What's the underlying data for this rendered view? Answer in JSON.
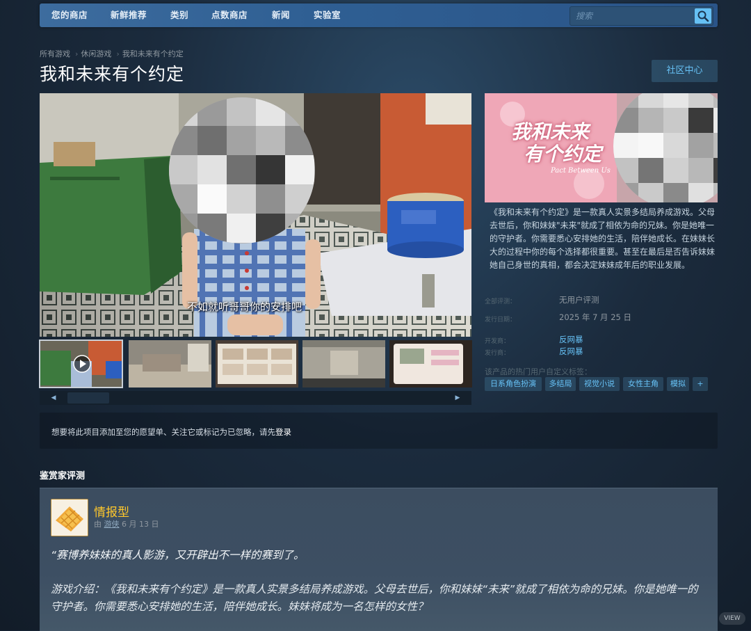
{
  "nav": {
    "tabs": [
      "您的商店",
      "新鲜推荐",
      "类别",
      "点数商店",
      "新闻",
      "实验室"
    ],
    "search_placeholder": "搜索"
  },
  "breadcrumb": [
    "所有游戏",
    "休闲游戏",
    "我和未来有个约定"
  ],
  "game": {
    "title": "我和未来有个约定",
    "community_hub": "社区中心",
    "video_subtitle": "不如就听哥哥你的安排吧",
    "capsule_title_line1": "我和未来",
    "capsule_title_line2": "有个约定",
    "capsule_subtitle": "Pact Between Us",
    "description": "《我和未来有个约定》是一款真人实景多结局养成游戏。父母去世后，你和妹妹\"未来\"就成了相依为命的兄妹。你是她唯一的守护者。你需要悉心安排她的生活，陪伴她成长。在妹妹长大的过程中你的每个选择都很重要。甚至在最后是否告诉妹妹她自己身世的真相，都会决定妹妹成年后的职业发展。",
    "info": {
      "reviews_label": "全部评测：",
      "reviews_value": "无用户评测",
      "release_label": "发行日期：",
      "release_value": "2025 年 7 月 25 日",
      "developer_label": "开发商：",
      "developer_value": "反网暴",
      "publisher_label": "发行商：",
      "publisher_value": "反网暴"
    },
    "tags_label": "该产品的热门用户自定义标签：",
    "tags": [
      "日系角色扮演",
      "多结局",
      "视觉小说",
      "女性主角",
      "模拟",
      "+"
    ]
  },
  "notice": {
    "text": "想要将此项目添加至您的愿望单、关注它或标记为已忽略，请先",
    "link": "登录"
  },
  "curator": {
    "section_title": "鉴赏家评测",
    "name": "情报型",
    "meta_prefix": "由",
    "meta_author": "游侠",
    "meta_date": "6 月 13 日",
    "quote": "“赛博养妹妹的真人影游，又开辟出不一样的赛到了。",
    "body": "游戏介绍：《我和未来有个约定》是一款真人实景多结局养成游戏。父母去世后，你和妹妹“未来”就成了相依为命的兄妹。你是她唯一的守护者。你需要悉心安排她的生活，陪伴她成长。妹妹将成为一名怎样的女性？"
  },
  "corner_badge": "VIEW",
  "colors": {
    "accent": "#66c0f4",
    "curator_gold": "#ffc82c",
    "nav_blue": "#3d6c9e"
  }
}
